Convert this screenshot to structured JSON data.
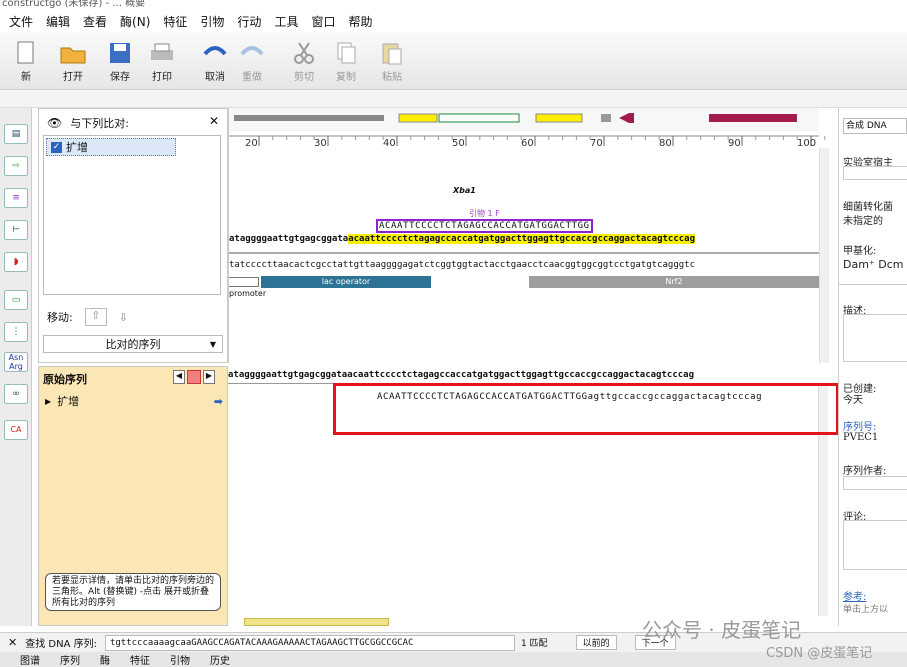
{
  "window": {
    "title": "constructgo  (未保存) - ...  概要"
  },
  "menu": [
    "文件",
    "编辑",
    "查看",
    "酶(N)",
    "特征",
    "引物",
    "行动",
    "工具",
    "窗口",
    "帮助"
  ],
  "toolbar": {
    "new": "新",
    "open": "打开",
    "save": "保存",
    "print": "打印",
    "undo": "取消",
    "redo": "重做",
    "cut": "剪切",
    "copy": "复制",
    "paste": "粘贴"
  },
  "align_panel": {
    "header": "与下列比对:",
    "item": "扩增",
    "move_label": "移动:",
    "seq_select": "比对的序列"
  },
  "orig_panel": {
    "header": "原始序列",
    "item": "扩增",
    "tip": "若要显示详情，请单击比对的序列旁边的三角形。Alt (替换键) -点击 展开或折叠所有比对的序列"
  },
  "ruler": {
    "ticks": [
      "20",
      "30",
      "40",
      "50",
      "60",
      "70",
      "80",
      "90",
      "100"
    ]
  },
  "seq_view": {
    "site_label": "Xba1",
    "primer_label": "引物 1 F",
    "primer_seq": "ACAATTCCCCTCTAGAGCCACCATGATGGACTTGG",
    "top_strand_a": "ataggggaattgtgagcggata",
    "top_strand_b": "acaattcccctctagagccaccatgatggacttggagttgccaccgccaggactacagtcccag",
    "bottom_strand": "tatccccttaacactcgcctattgttaaggggagatctcggtggtactacctgaacctcaacggtggcggtcctgatgtcagggtc",
    "feature_promoter": "promoter",
    "feature_lac": "lac operator",
    "feature_nrf2": "Nrf2"
  },
  "align_view": {
    "ref_seq": "ataggggaattgtgagcggataacaattcccctctagagccaccatgatggacttggagttgccaccgccaggactacagtcccag",
    "aligned_upper": "ACAATTCCCCTCTAGAGCCACCATGATGGACTTGG",
    "aligned_lower": "agttgccaccgccaggactacagtcccag"
  },
  "right_panel": {
    "synth": "合成 DNA",
    "host_label": "实验室宿主",
    "transform_label": "细菌转化菌",
    "unspecified": "未指定的",
    "methyl_label": "甲基化:",
    "methyl_value": "Dam⁺ Dcm",
    "desc_label": "描述:",
    "created_label": "已创建:",
    "created_value": "今天",
    "seqno_label": "序列号:",
    "seqno_value": "PVEC1",
    "author_label": "序列作者:",
    "comment_label": "评论:",
    "ref_label": "参考:",
    "ref_hint": "单击上方以"
  },
  "bottom": {
    "find_label": "查找 DNA 序列:",
    "find_value": "tgttcccaaaagcaaGAAGCCAGATACAAAGAAAAACTAGAAGCTTGCGGCCGCAC",
    "match_count": "1 匹配",
    "prev": "以前的",
    "next": "下一个"
  },
  "tabs": [
    "图谱",
    "序列",
    "酶",
    "特征",
    "引物",
    "历史"
  ],
  "watermark": "公众号 · 皮蛋笔记",
  "watermark2": "CSDN @皮蛋笔记"
}
